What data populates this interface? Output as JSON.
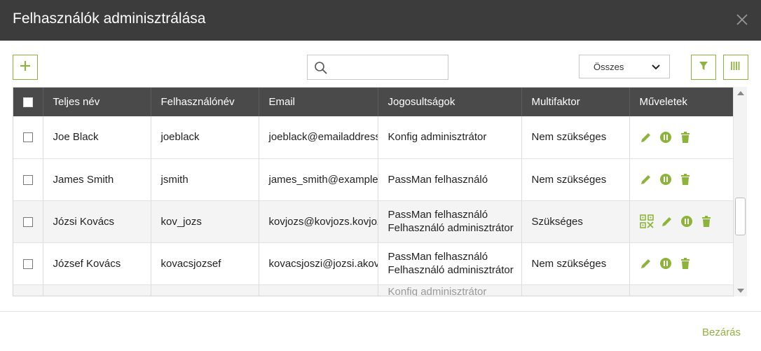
{
  "dialog": {
    "title": "Felhasználók adminisztrálása"
  },
  "toolbar": {
    "search_placeholder": "",
    "filter_select": "Összes"
  },
  "table": {
    "columns": [
      "Teljes név",
      "Felhasználónév",
      "Email",
      "Jogosultságok",
      "Multifaktor",
      "Műveletek"
    ],
    "rows": [
      {
        "name": "Joe Black",
        "username": "joeblack",
        "email": "joeblack@emailaddress",
        "roles": [
          "Konfig adminisztrátor"
        ],
        "mfa": "Nem szükséges"
      },
      {
        "name": "James Smith",
        "username": "jsmith",
        "email": "james_smith@example",
        "roles": [
          "PassMan felhasználó"
        ],
        "mfa": "Nem szükséges"
      },
      {
        "name": "Józsi Kovács",
        "username": "kov_jozs",
        "email": "kovjozs@kovjozs.kovjoz",
        "roles": [
          "PassMan felhasználó",
          "Felhasználó adminisztrátor"
        ],
        "mfa": "Szükséges"
      },
      {
        "name": "József Kovács",
        "username": "kovacsjozsef",
        "email": "kovacsjoszi@jozsi.akov",
        "roles": [
          "PassMan felhasználó",
          "Felhasználó adminisztrátor"
        ],
        "mfa": "Nem szükséges"
      },
      {
        "name": "",
        "username": "",
        "email": "",
        "roles": [
          "Konfig adminisztrátor"
        ],
        "mfa": ""
      }
    ]
  },
  "footer": {
    "close_label": "Bezárás"
  },
  "colors": {
    "header_bg": "#3c3c3c",
    "table_header_bg": "#4a4a4a",
    "accent": "#8fb33f",
    "action_icon": "#8db43a"
  }
}
